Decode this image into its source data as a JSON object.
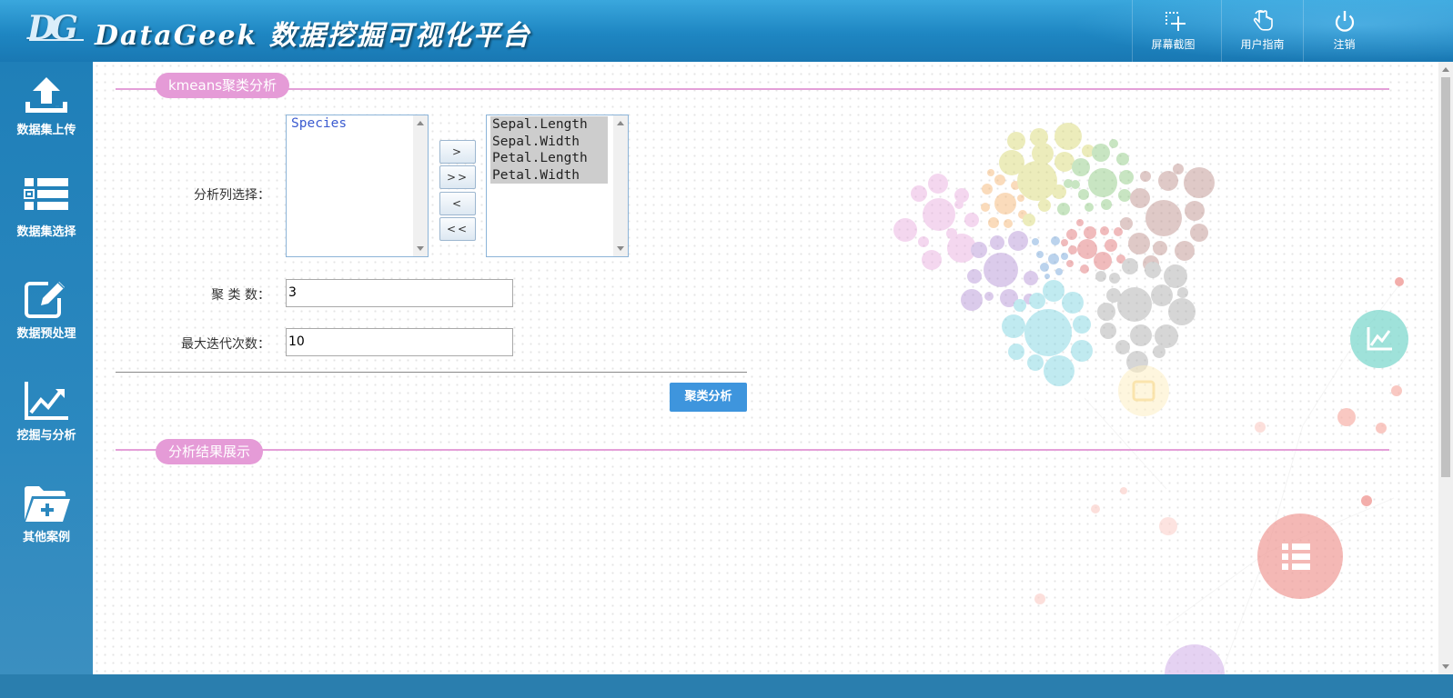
{
  "header": {
    "logo_letters": "DG",
    "title": "DataGeek 数据挖掘可视化平台",
    "buttons": [
      {
        "label": "屏幕截图",
        "icon": "screenshot-icon"
      },
      {
        "label": "用户指南",
        "icon": "hand-pointer-icon"
      },
      {
        "label": "注销",
        "icon": "power-icon"
      }
    ]
  },
  "sidebar": {
    "items": [
      {
        "label": "数据集上传",
        "icon": "upload-icon"
      },
      {
        "label": "数据集选择",
        "icon": "list-icon"
      },
      {
        "label": "数据预处理",
        "icon": "edit-icon"
      },
      {
        "label": "挖掘与分析",
        "icon": "chart-line-icon"
      },
      {
        "label": "其他案例",
        "icon": "folder-add-icon"
      }
    ]
  },
  "main": {
    "section1_title": "kmeans聚类分析",
    "column_select_label": "分析列选择：",
    "available_columns": [
      "Species"
    ],
    "selected_columns": [
      "Sepal.Length",
      "Sepal.Width",
      "Petal.Length",
      "Petal.Width"
    ],
    "move_buttons": [
      ">",
      ">>",
      "<",
      "<<"
    ],
    "cluster_count_label": "聚 类 数：",
    "cluster_count_value": "3",
    "max_iter_label": "最大迭代次数：",
    "max_iter_value": "10",
    "submit_label": "聚类分析",
    "section2_title": "分析结果展示"
  },
  "colors": {
    "header_blue": "#1e86c2",
    "sidebar_blue": "#2b88bf",
    "section_pink": "#e59bd7",
    "primary_button": "#3e95dd"
  }
}
